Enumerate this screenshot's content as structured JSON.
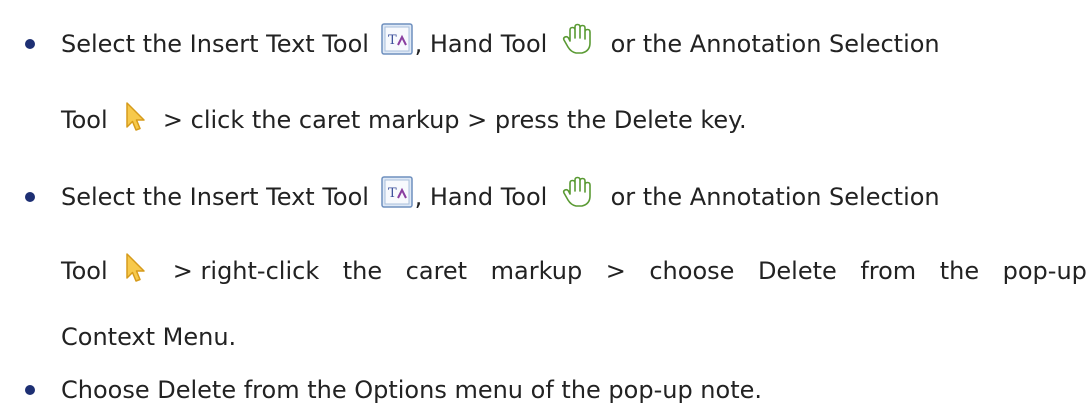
{
  "items": [
    {
      "line1": {
        "text_a": "Select the Insert Text Tool",
        "sep_a": ",",
        "text_b": "Hand Tool",
        "text_c": "or the Annotation Selection"
      },
      "line2": {
        "text_a": "Tool",
        "text_b": "> click the caret markup > press the Delete key."
      }
    },
    {
      "line1": {
        "text_a": "Select the Insert Text Tool",
        "sep_a": ",",
        "text_b": "Hand Tool",
        "text_c": "or the Annotation Selection"
      },
      "line2": {
        "text_a": "Tool",
        "words": [
          "> right-click",
          "the",
          "caret",
          "markup",
          ">",
          "choose",
          "Delete",
          "from",
          "the",
          "pop-up"
        ]
      },
      "line3": {
        "text": "Context Menu."
      }
    },
    {
      "line1": {
        "text": "Choose Delete from the Options menu of the pop-up note."
      }
    }
  ],
  "icons": {
    "insert_text_tool": "insert-text-tool-icon",
    "hand_tool": "hand-tool-icon",
    "annotation_selection_tool": "annotation-selection-tool-icon"
  },
  "colors": {
    "text": "#222222",
    "bullet": "#1d2f73"
  }
}
